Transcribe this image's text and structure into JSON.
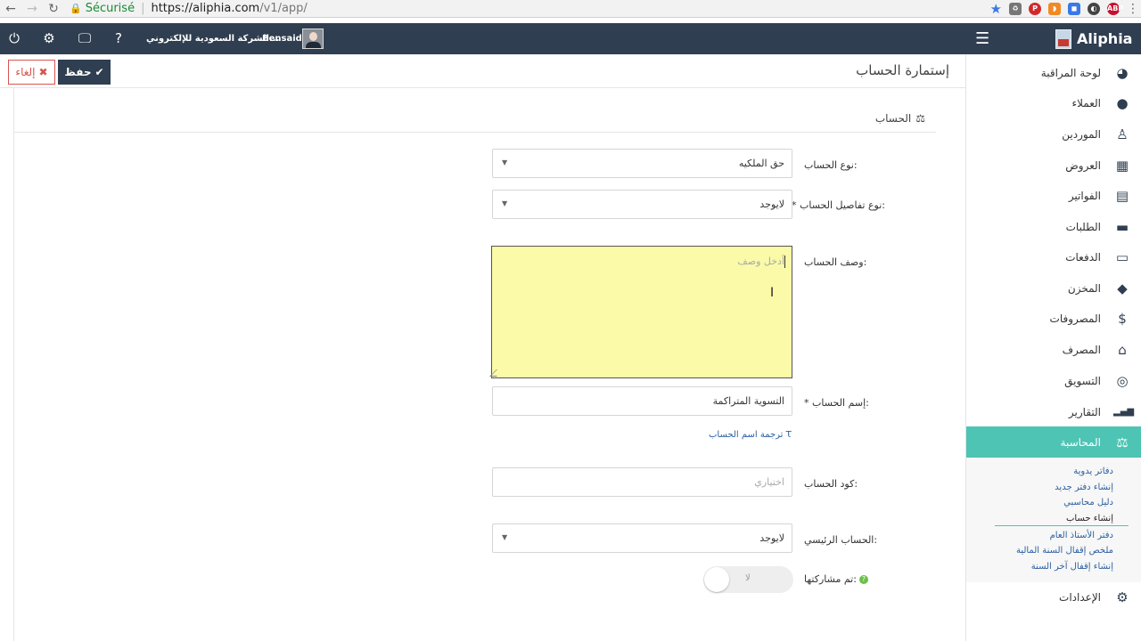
{
  "browser": {
    "secure_label": "Sécurisé",
    "url_host": "https://aliphia.com",
    "url_path": "/v1/app/"
  },
  "topbar": {
    "company": "الشركة السعودية للإلكتروني...",
    "username": "Bensaid",
    "brand": "Aliphia"
  },
  "sidebar": {
    "items": [
      {
        "label": "لوحة المراقبة",
        "icon": "dashboard-icon",
        "glyph": "◕"
      },
      {
        "label": "العملاء",
        "icon": "user-icon",
        "glyph": "👤"
      },
      {
        "label": "الموردين",
        "icon": "supplier-icon",
        "glyph": "♙"
      },
      {
        "label": "العروض",
        "icon": "calculator-icon",
        "glyph": "▦"
      },
      {
        "label": "الفواتير",
        "icon": "invoice-icon",
        "glyph": "▤"
      },
      {
        "label": "الطلبات",
        "icon": "briefcase-icon",
        "glyph": "▬"
      },
      {
        "label": "الدفعات",
        "icon": "credit-card-icon",
        "glyph": "▭"
      },
      {
        "label": "المخزن",
        "icon": "box-icon",
        "glyph": "◆"
      },
      {
        "label": "المصروفات",
        "icon": "dollar-icon",
        "glyph": "$"
      },
      {
        "label": "المصرف",
        "icon": "bank-icon",
        "glyph": "⌂"
      },
      {
        "label": "التسويق",
        "icon": "target-icon",
        "glyph": "◎"
      },
      {
        "label": "التقارير",
        "icon": "bar-chart-icon",
        "glyph": "▂▄▆"
      },
      {
        "label": "المحاسبة",
        "icon": "scale-icon",
        "glyph": "⚖"
      }
    ],
    "submenu": [
      "دفاتر يدوية",
      "إنشاء دفتر جديد",
      "دليل محاسبي",
      "إنشاء حساب",
      "دفتر الأستاذ العام",
      "ملخص إقفال السنة المالية",
      "إنشاء إقفال آخر السنة"
    ],
    "settings_label": "الإعدادات",
    "accent": "#4ec4b4"
  },
  "page": {
    "title": "إستمارة الحساب",
    "save_label": "حفظ",
    "cancel_label": "إلغاء",
    "section_title": "الحساب"
  },
  "form": {
    "account_type_label": "نوع الحساب:",
    "account_type_value": "حق الملكيه",
    "detail_type_label": "* نوع تفاصيل الحساب:",
    "detail_type_value": "لايوجد",
    "description_label": "وصف الحساب:",
    "description_placeholder": "أدخل وصف",
    "name_label": "* إسم الحساب:",
    "name_value": "التسوية المتراكمة",
    "translate_link": "ترجمة اسم الحساب",
    "code_label": "كود الحساب:",
    "code_placeholder": "اختياري",
    "parent_label": "الحساب الرئيسي:",
    "parent_value": "لايوجد",
    "shared_label": "تم مشاركتها:",
    "shared_toggle_text": "لا"
  }
}
